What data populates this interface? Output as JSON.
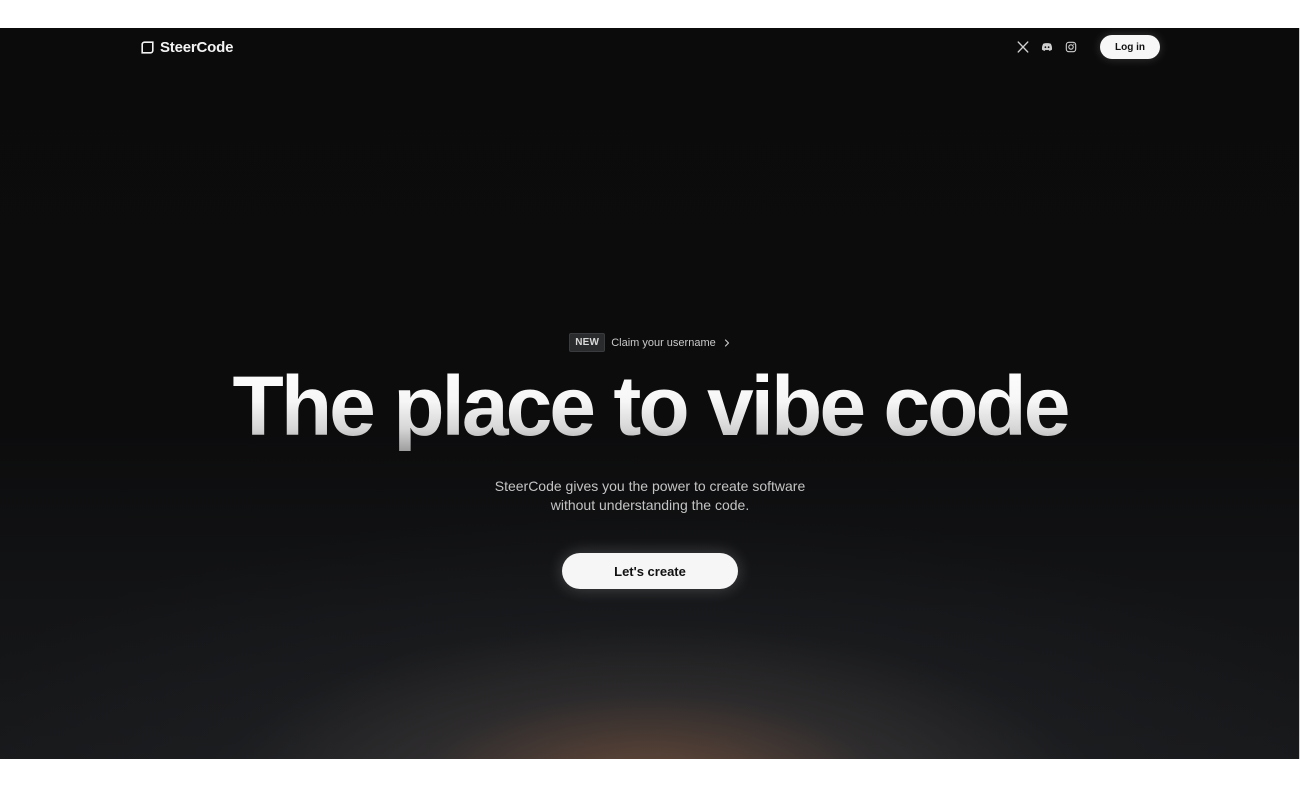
{
  "header": {
    "brand": "SteerCode",
    "socials": [
      {
        "icon": "x-icon",
        "name": "X"
      },
      {
        "icon": "discord-icon",
        "name": "Discord"
      },
      {
        "icon": "instagram-icon",
        "name": "Instagram"
      }
    ],
    "login_label": "Log in"
  },
  "hero": {
    "badge": "NEW",
    "announcement": "Claim your username",
    "headline": "The place to vibe code",
    "subtitle_line1": "SteerCode gives you the power to create software",
    "subtitle_line2": "without understanding the code.",
    "cta_label": "Let's create"
  },
  "colors": {
    "background": "#0b0b0c",
    "text": "#f4f4f4",
    "muted_text": "#c4c4c4",
    "button_bg": "#f6f6f6",
    "glow": "#965c3a"
  }
}
